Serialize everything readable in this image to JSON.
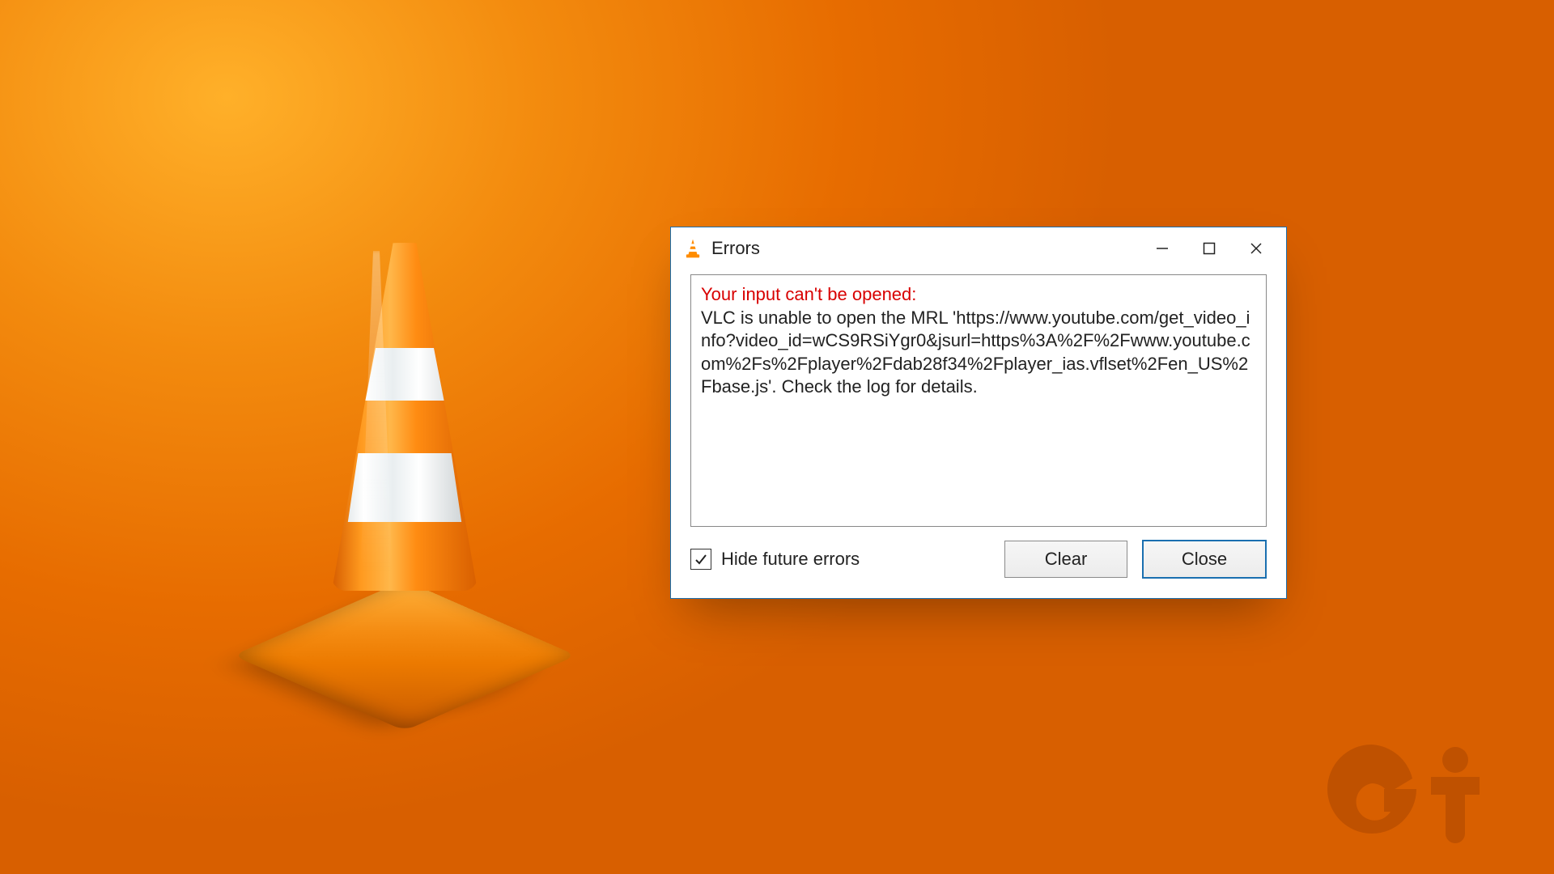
{
  "dialog": {
    "title": "Errors",
    "error_title": "Your input can't be opened:",
    "error_body": "VLC is unable to open the MRL 'https://www.youtube.com/get_video_info?video_id=wCS9RSiYgr0&jsurl=https%3A%2F%2Fwww.youtube.com%2Fs%2Fplayer%2Fdab28f34%2Fplayer_ias.vflset%2Fen_US%2Fbase.js'. Check the log for details.",
    "hide_future_label": "Hide future errors",
    "hide_future_checked": true,
    "clear_label": "Clear",
    "close_label": "Close"
  },
  "colors": {
    "error_text": "#d80000",
    "accent": "#1a6fb0"
  }
}
